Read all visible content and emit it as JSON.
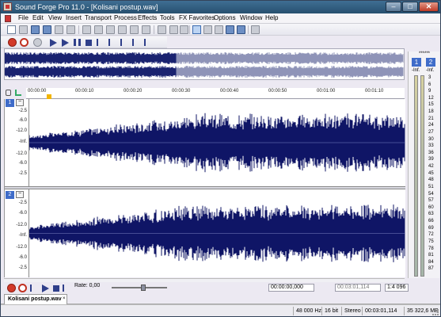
{
  "window": {
    "title": "Sound Forge Pro 11.0 - [Kolisani postup.wav]",
    "minimize": "–",
    "maximize": "□",
    "close": "✕"
  },
  "menu": [
    "File",
    "Edit",
    "View",
    "Insert",
    "Transport",
    "Process",
    "Effects",
    "Tools",
    "FX Favorites",
    "Options",
    "Window",
    "Help"
  ],
  "overview": {
    "played_fraction": 0.43
  },
  "ruler": {
    "ticks": [
      "00:00:00",
      "00:00:10",
      "00:00:20",
      "00:00:30",
      "00:00:40",
      "00:00:50",
      "00:01:00",
      "00:01:10"
    ]
  },
  "channels": [
    {
      "number": "1",
      "collapse": "−",
      "scale": [
        "-2.5",
        "-6.0",
        "-12.0",
        "-Inf.",
        "-12.0",
        "-6.0",
        "-2.5"
      ]
    },
    {
      "number": "2",
      "collapse": "−",
      "scale": [
        "-2.5",
        "-6.0",
        "-12.0",
        "-Inf.",
        "-12.0",
        "-6.0",
        "-2.5"
      ]
    }
  ],
  "meter": {
    "top_label": "******",
    "ch1_btn": "1",
    "ch2_btn": "2",
    "ch1_level": "-Inf.",
    "ch2_level": "-Inf.",
    "scale": [
      "3",
      "6",
      "9",
      "12",
      "15",
      "18",
      "21",
      "24",
      "27",
      "30",
      "33",
      "36",
      "39",
      "42",
      "45",
      "48",
      "51",
      "54",
      "57",
      "60",
      "63",
      "66",
      "69",
      "72",
      "75",
      "78",
      "81",
      "84",
      "87"
    ]
  },
  "transport": {
    "rate_label": "Rate: 0,00",
    "selection_start": "00:00:00,000",
    "selection_length": "00:03:01,114",
    "zoom": "1:4 096"
  },
  "tab": {
    "label": "Kolisani postup.wav",
    "close": "×"
  },
  "status": {
    "sample_rate": "48 000 Hz",
    "bit_depth": "16 bit",
    "channels": "Stereo",
    "length": "00:03:01,114",
    "free_space": "35 322,6 MB"
  },
  "colors": {
    "waveform": "#0f1566",
    "overview_played": "#1a2370",
    "overview_unplayed": "#8f94b8",
    "channel_badge": "#3f6cc9"
  }
}
